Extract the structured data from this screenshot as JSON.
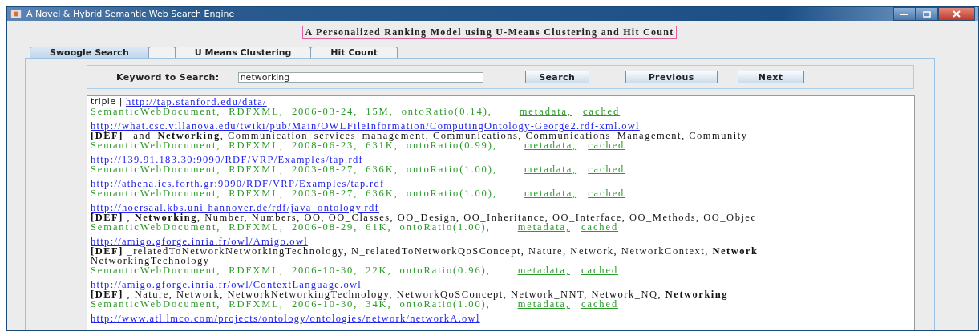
{
  "window": {
    "title": "A Novel & Hybrid Semantic Web Search Engine"
  },
  "heading": "A Personalized Ranking Model using U-Means Clustering and Hit Count",
  "tabs": [
    {
      "kind": "label",
      "label": "Swoogle Search",
      "selected": true
    },
    {
      "kind": "empty",
      "selected": false
    },
    {
      "kind": "label",
      "label": "U Means Clustering",
      "selected": false
    },
    {
      "kind": "label",
      "label": "Hit Count",
      "selected": false
    }
  ],
  "search": {
    "label": "Keyword to Search:",
    "value": "networking",
    "buttons": [
      "Search",
      "Previous",
      "Next"
    ]
  },
  "results": [
    {
      "prefix": "triple | ",
      "url": "http://tap.stanford.edu/data/",
      "meta": "SemanticWebDocument,  RDFXML,  2006-03-24,  15M,  ontoRatio(0.14),",
      "links": [
        "metadata,",
        "cached"
      ]
    },
    {
      "url": "http://what.csc.villanova.edu/twiki/pub/Main/OWLFileInformation/ComputingOntology-George2.rdf-xml.owl",
      "def_lines": [
        "**[DEF]** _and_**Networking**, Communication_services_management, Communications, Communications_Management, Community"
      ],
      "meta": "SemanticWebDocument,  RDFXML,  2008-06-23,  631K,  ontoRatio(0.99),",
      "links": [
        "metadata,",
        "cached"
      ]
    },
    {
      "url": "http://139.91.183.30:9090/RDF/VRP/Examples/tap.rdf",
      "meta": "SemanticWebDocument,  RDFXML,  2003-08-27,  636K,  ontoRatio(1.00),",
      "links": [
        "metadata,",
        "cached"
      ]
    },
    {
      "url": "http://athena.ics.forth.gr:9090/RDF/VRP/Examples/tap.rdf",
      "meta": "SemanticWebDocument,  RDFXML,  2003-08-27,  636K,  ontoRatio(1.00),",
      "links": [
        "metadata,",
        "cached"
      ]
    },
    {
      "url": "http://hoersaal.kbs.uni-hannover.de/rdf/java_ontology.rdf",
      "def_lines": [
        "**[DEF]** , **Networking**, Number, Numbers, OO, OO_Classes, OO_Design, OO_Inheritance, OO_Interface, OO_Methods, OO_Objec"
      ],
      "meta": "SemanticWebDocument,  RDFXML,  2006-08-29,  61K,  ontoRatio(1.00),",
      "links": [
        "metadata,",
        "cached"
      ]
    },
    {
      "url": "http://amigo.gforge.inria.fr/owl/Amigo.owl",
      "def_lines": [
        "**[DEF]** _relatedToNetworkNetworkingTechnology, N_relatedToNetworkQoSConcept, Nature, Network, NetworkContext, **Network**",
        "NetworkingTechnology"
      ],
      "meta": "SemanticWebDocument,  RDFXML,  2006-10-30,  22K,  ontoRatio(0.96),",
      "links": [
        "metadata,",
        "cached"
      ]
    },
    {
      "url": "http://amigo.gforge.inria.fr/owl/ContextLanguage.owl",
      "def_lines": [
        "**[DEF]** , Nature, Network, NetworkNetworkingTechnology, NetworkQoSConcept, Network_NNT, Network_NQ, **Networking**"
      ],
      "meta": "SemanticWebDocument,  RDFXML,  2006-10-30,  34K,  ontoRatio(1.00),",
      "links": [
        "metadata,",
        "cached"
      ]
    },
    {
      "url": "http://www.atl.lmco.com/projects/ontology/ontologies/network/networkA.owl"
    }
  ]
}
